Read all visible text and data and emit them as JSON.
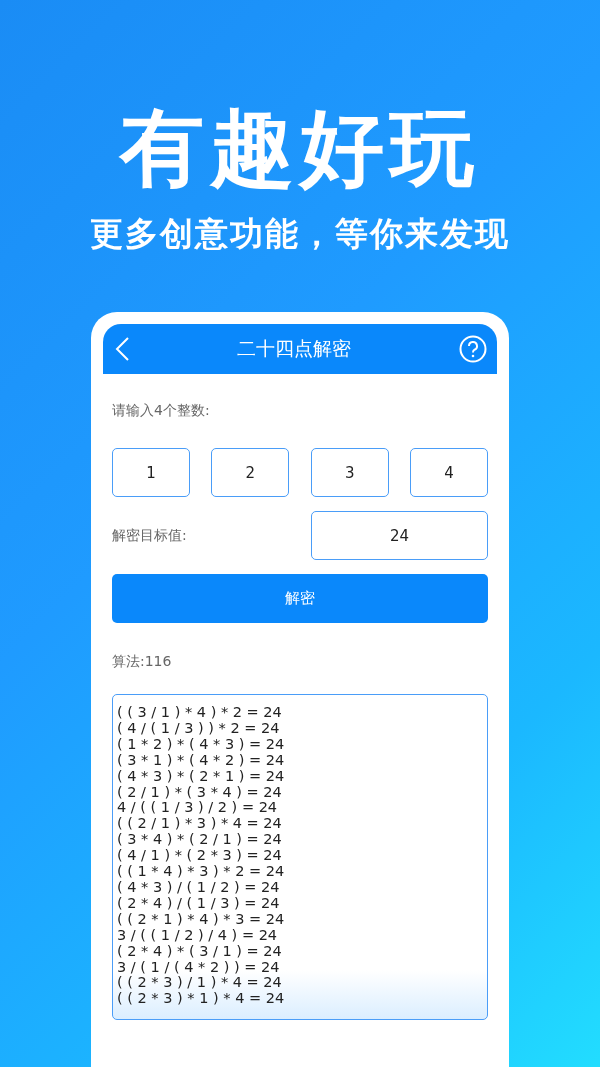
{
  "headline": "有趣好玩",
  "subtitle": "更多创意功能，等你来发现",
  "app": {
    "title": "二十四点解密",
    "prompt": "请输入4个整数:",
    "numbers": [
      "1",
      "2",
      "3",
      "4"
    ],
    "target_label": "解密目标值:",
    "target_value": "24",
    "solve_button": "解密",
    "count_label": "算法:116",
    "results": [
      "( ( 3 / 1 ) * 4 ) * 2 = 24",
      "( 4 / ( 1 / 3 ) ) * 2 = 24",
      "( 1 * 2 ) * ( 4 * 3 ) = 24",
      "( 3 * 1 ) * ( 4 * 2 ) = 24",
      "( 4 * 3 ) * ( 2 * 1 ) = 24",
      "( 2 / 1 ) * ( 3 * 4 ) = 24",
      "4 / ( ( 1 / 3 ) / 2 ) = 24",
      "( ( 2 / 1 ) * 3 ) * 4 = 24",
      "( 3 * 4 ) * ( 2 / 1 ) = 24",
      "( 4 / 1 ) * ( 2 * 3 ) = 24",
      "( ( 1 * 4 ) * 3 ) * 2 = 24",
      "( 4 * 3 ) / ( 1 / 2 ) = 24",
      "( 2 * 4 ) / ( 1 / 3 ) = 24",
      "( ( 2 * 1 ) * 4 ) * 3 = 24",
      "3 / ( ( 1 / 2 ) / 4 ) = 24",
      "( 2 * 4 ) * ( 3 / 1 ) = 24",
      "3 / ( 1 / ( 4 * 2 ) ) = 24",
      "( ( 2 * 3 ) / 1 ) * 4 = 24",
      "( ( 2 * 3 ) * 1 ) * 4 = 24"
    ]
  }
}
